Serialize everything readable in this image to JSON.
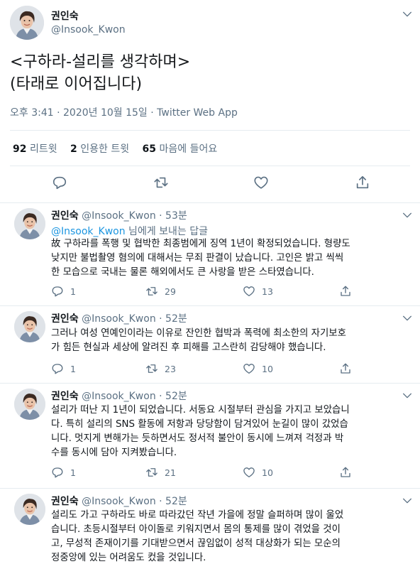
{
  "author": {
    "name": "권인숙",
    "handle": "@Insook_Kwon",
    "reply_handle": "@Insook_Kwon"
  },
  "main_tweet": {
    "text_lines": [
      "<구하라-설리를 생각하며>",
      "(타래로 이어집니다)"
    ],
    "meta": "오후 3:41 · 2020년 10월 15일 · Twitter Web App",
    "stats": {
      "retweets_count": "92",
      "retweets_label": "리트윗",
      "quotes_count": "2",
      "quotes_label": "인용한 트윗",
      "likes_count": "65",
      "likes_label": "마음에 들어요"
    },
    "actions": [
      "reply-icon",
      "retweet-icon",
      "like-icon",
      "share-icon"
    ]
  },
  "replies": [
    {
      "time": "· 53분",
      "reply_to_mention": "@Insook_Kwon",
      "reply_to_suffix": " 님에게 보내는 답글",
      "lines": [
        "故 구하라를 폭행 및 협박한 최종범에게 징역 1년이 확정되었습니다. 형량도",
        "낮지만 불법촬영 혐의에 대해서는 무죄 판결이 났습니다. 고인은 밝고 씩씩",
        "한 모습으로 국내는 물론 해외에서도 큰 사랑을 받은 스타였습니다."
      ],
      "replies": "1",
      "retweets": "29",
      "likes": "13"
    },
    {
      "time": "· 52분",
      "lines": [
        "그러나 여성 연예인이라는 이유로 잔인한 협박과 폭력에 최소한의 자기보호",
        "가 힘든 현실과 세상에 알려진 후 피해를 고스란히 감당해야 했습니다."
      ],
      "replies": "1",
      "retweets": "23",
      "likes": "10"
    },
    {
      "time": "· 52분",
      "lines": [
        "설리가 떠난 지 1년이 되었습니다. 서동요 시절부터 관심을 가지고 보았습니",
        "다. 특히 설리의 SNS 활동에 저항과 당당함이 담겨있어 눈길이 많이 갔었습",
        "니다. 멋지게 변해가는 듯하면서도 정서적 불안이 동시에 느껴져 걱정과 박",
        "수를 동시에 담아 지켜봤습니다."
      ],
      "replies": "1",
      "retweets": "21",
      "likes": "10"
    },
    {
      "time": "· 52분",
      "lines": [
        "설리도 가고 구하라도 바로 따라갔던 작년 가을에 정말 슬퍼하며 많이 울었",
        "습니다. 초등시절부터 아이돌로 키워지면서 몸의 통제를 많이 겪었을 것이",
        "고, 무성적 존재이기를 기대받으면서 끊임없이 성적 대상화가 되는 모순의",
        "정중앙에 있는 어려움도 컸을 것입니다."
      ]
    }
  ],
  "colors": {
    "accent": "#1b95e0",
    "secondary_text": "#5b7083",
    "divider": "#e6ecf0"
  }
}
